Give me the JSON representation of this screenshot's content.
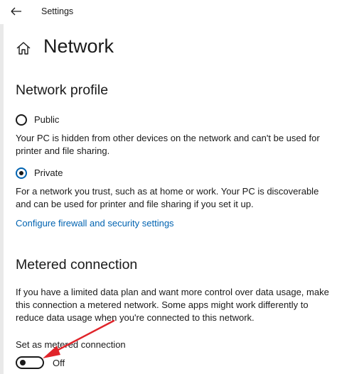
{
  "window": {
    "title": "Settings"
  },
  "icons": {
    "back": "back-arrow-icon",
    "home": "home-icon"
  },
  "page": {
    "title": "Network"
  },
  "network_profile": {
    "heading": "Network profile",
    "options": [
      {
        "label": "Public",
        "selected": false,
        "description": "Your PC is hidden from other devices on the network and can't be used for printer and file sharing."
      },
      {
        "label": "Private",
        "selected": true,
        "description": "For a network you trust, such as at home or work. Your PC is discoverable and can be used for printer and file sharing if you set it up."
      }
    ],
    "firewall_link": "Configure firewall and security settings"
  },
  "metered": {
    "heading": "Metered connection",
    "description": "If you have a limited data plan and want more control over data usage, make this connection a metered network. Some apps might work differently to reduce data usage when you're connected to this network.",
    "toggle_label": "Set as metered connection",
    "toggle_state": "Off"
  },
  "colors": {
    "accent": "#0063b1",
    "annotation": "#e0242a"
  }
}
